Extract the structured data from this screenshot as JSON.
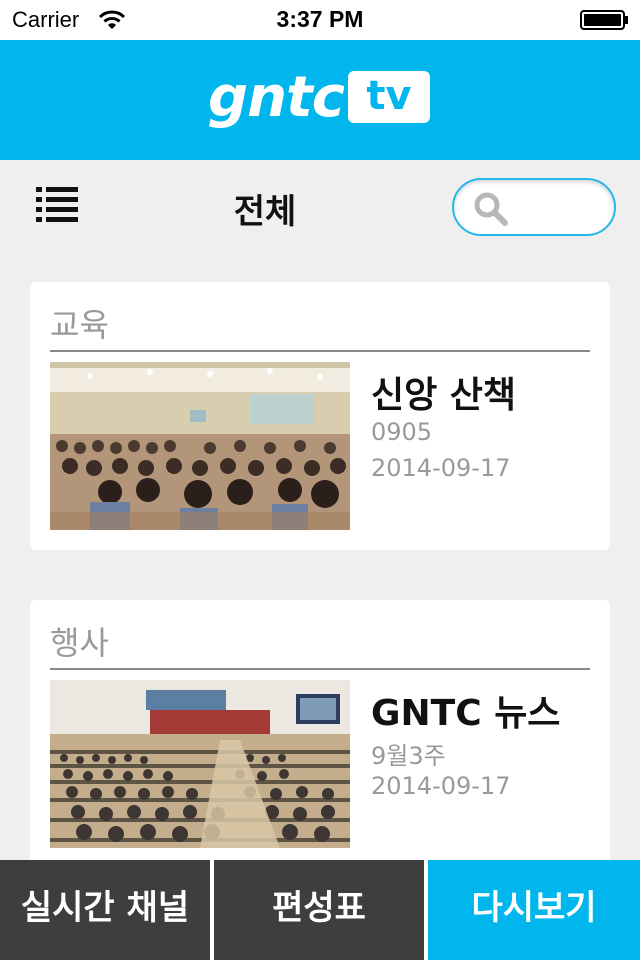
{
  "status_bar": {
    "carrier": "Carrier",
    "time": "3:37 PM"
  },
  "header": {
    "logo_text": "gntc",
    "logo_badge": "tv",
    "background_color": "#00b6ec"
  },
  "toolbar": {
    "title": "전체",
    "search_placeholder": ""
  },
  "cards": [
    {
      "category": "교육",
      "title": "신앙 산책",
      "subtitle": "0905",
      "date": "2014-09-17"
    },
    {
      "category": "행사",
      "title": "GNTC 뉴스",
      "subtitle": "9월3주",
      "date": "2014-09-17"
    }
  ],
  "tabbar": {
    "live_label": "실시간 채널",
    "schedule_label": "편성표",
    "replay_label": "다시보기",
    "active_color": "#00b6ec",
    "inactive_color": "#403d3d"
  },
  "icons": [
    "wifi-icon",
    "battery-icon",
    "menu-icon",
    "search-icon"
  ]
}
